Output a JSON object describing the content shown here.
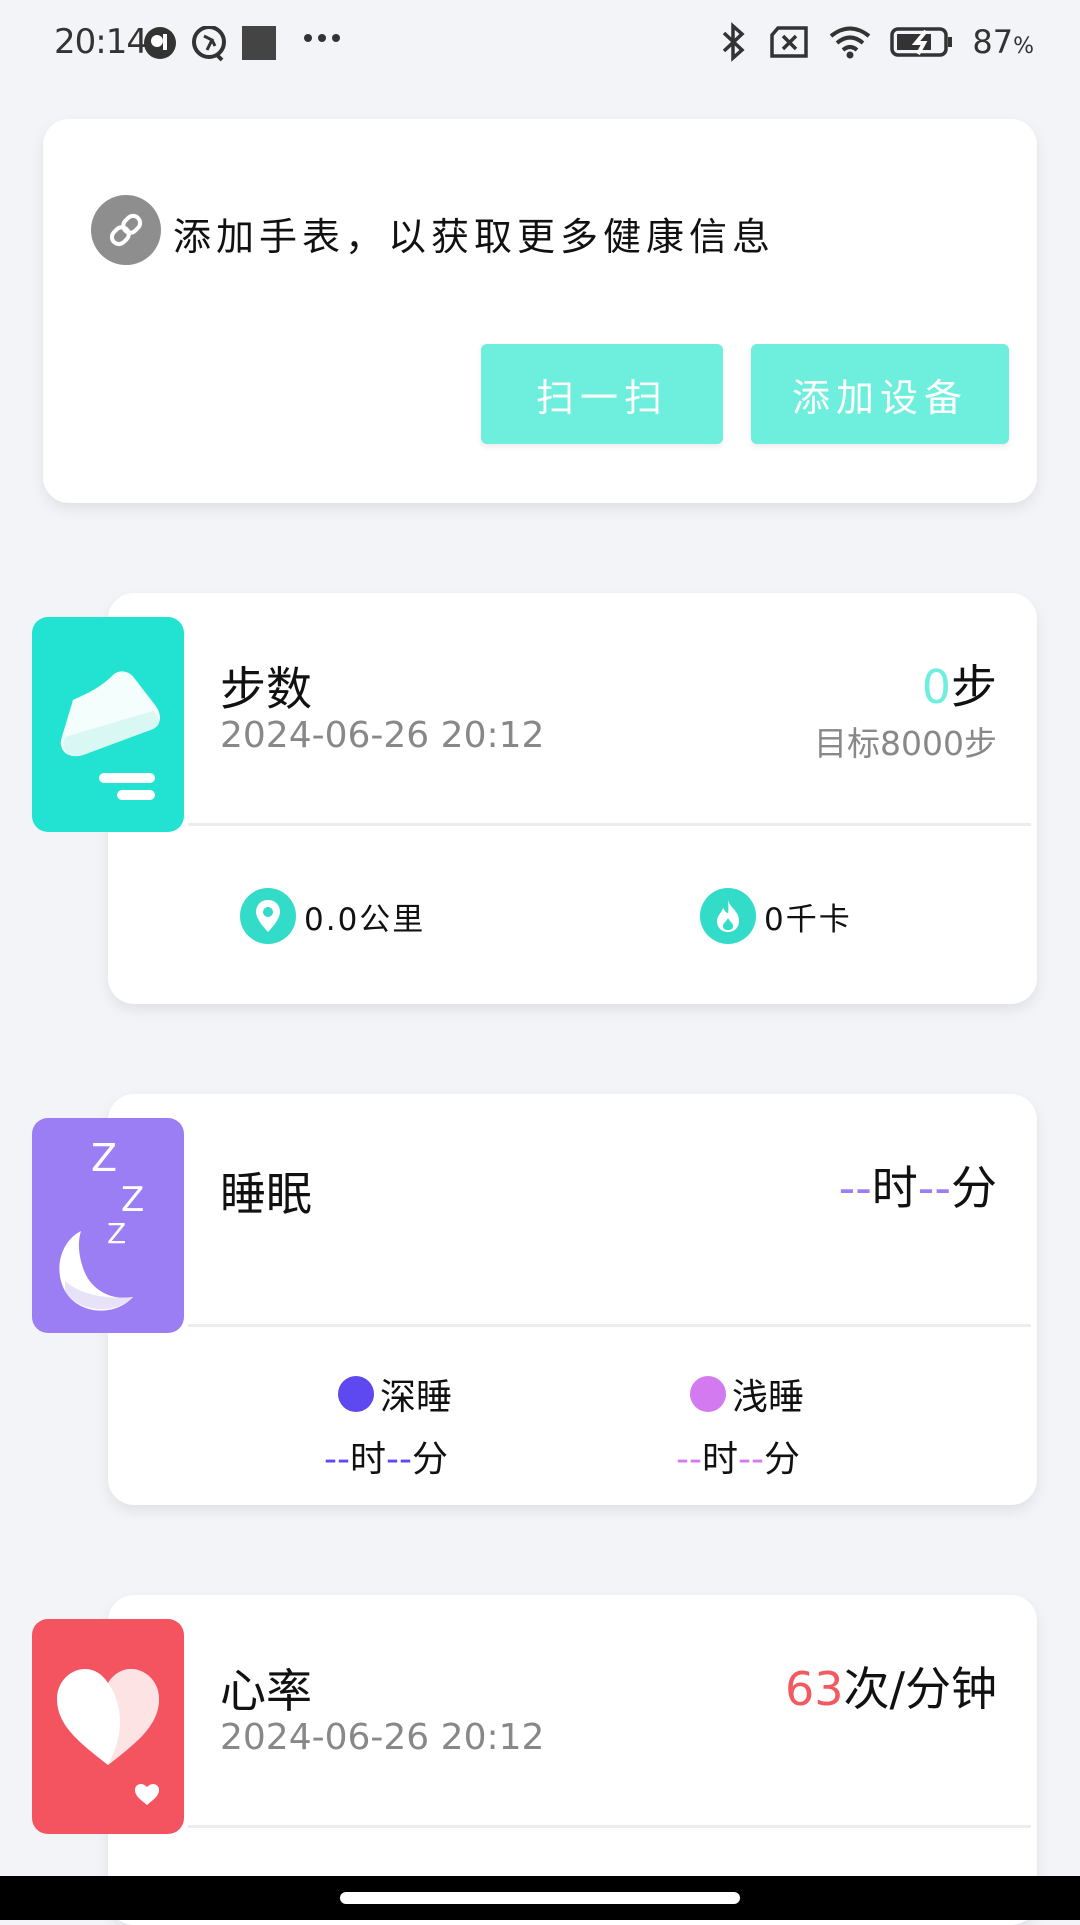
{
  "status_bar": {
    "time": "20:14",
    "battery": "87",
    "battery_unit": "%"
  },
  "add_watch": {
    "message": "添加手表，以获取更多健康信息",
    "scan_button": "扫一扫",
    "add_button": "添加设备"
  },
  "steps": {
    "title": "步数",
    "date": "2024-06-26  20:12",
    "value": "0",
    "unit": "步",
    "goal": "目标8000步",
    "distance": "0.0公里",
    "calories": "0千卡"
  },
  "sleep": {
    "title": "睡眠",
    "dash": "--",
    "hour": "时",
    "minute": "分",
    "deep_label": "深睡",
    "light_label": "浅睡"
  },
  "heart": {
    "title": "心率",
    "date": "2024-06-26  20:12",
    "value": "63",
    "unit": "次/分钟"
  },
  "colors": {
    "accent": "#6eeedd",
    "steps_tile": "#22e3d2",
    "sleep_tile": "#9b7ef4",
    "heart_tile": "#f4545f",
    "deep": "#5e48f0",
    "light": "#d47af0",
    "heart_value": "#f25a60"
  }
}
